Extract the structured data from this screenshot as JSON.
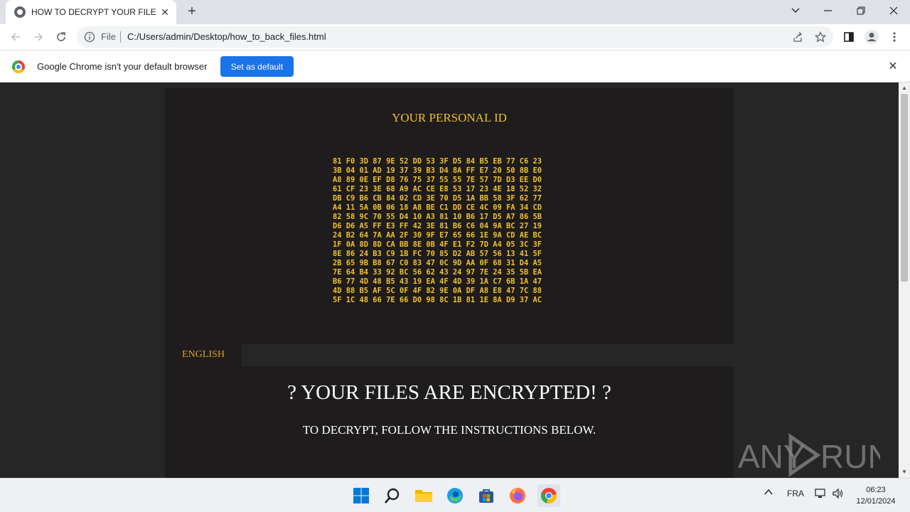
{
  "browser": {
    "tab_title": "HOW TO DECRYPT YOUR FILES",
    "new_tab_label": "+",
    "url_scheme_label": "File",
    "url": "C:/Users/admin/Desktop/how_to_back_files.html"
  },
  "infobar": {
    "message": "Google Chrome isn't your default browser",
    "button_label": "Set as default"
  },
  "page": {
    "id_title": "YOUR PERSONAL ID",
    "hex_lines": [
      "81 F0 3D 87 9E 52 DD 53 3F D5 84 B5 EB 77 C6 23",
      "3B 04 01 AD 19 37 39 B3 D4 8A FF E7 20 50 8B E0",
      "A8 89 0E EF D8 76 75 37 55 55 7E 57 7D D3 EE D0",
      "61 CF 23 3E 68 A9 AC CE E8 53 17 23 4E 18 52 32",
      "DB C9 B6 CB 84 02 CD 3E 70 D5 1A BB 58 3F 62 77",
      "A4 11 5A 0B 06 18 A8 BE C1 DD CE 4C 09 FA 34 CD",
      "82 58 9C 70 55 D4 10 A3 81 10 B6 17 D5 A7 86 5B",
      "D6 D6 A5 FF E3 FF 42 3E 81 B6 C6 04 9A BC 27 19",
      "24 B2 64 7A AA 2F 30 9F E7 65 66 1E 9A CD AE BC",
      "1F 0A 8D 8D CA BB 8E 0B 4F E1 F2 7D A4 05 3C 3F",
      "8E 86 24 B3 C9 1B FC 70 85 D2 AB 57 56 13 41 5F",
      "2B 65 9B B8 67 C0 83 47 0C 9D AA 0F 68 31 D4 A5",
      "7E 64 B4 33 92 BC 56 62 43 24 97 7E 24 35 5B EA",
      "B6 77 4D 48 B5 43 19 EA 4F 4D 39 1A C7 6B 1A 47",
      "4D 88 B5 AF 5C 0F 4F 82 9E 0A DF A8 E8 47 7C 88",
      "5F 1C 48 66 7E 66 D0 98 8C 1B 81 1E 8A D9 37 AC"
    ],
    "language_tab": "ENGLISH",
    "headline": "? YOUR FILES ARE ENCRYPTED! ?",
    "subline": "TO DECRYPT, FOLLOW THE INSTRUCTIONS BELOW."
  },
  "watermark": {
    "text": "ANY RUN"
  },
  "taskbar": {
    "language": "FRA",
    "time": "06:23",
    "date": "12/01/2024"
  },
  "colors": {
    "page_bg": "#262626",
    "panel_bg": "#1e1c1c",
    "accent_yellow": "#f0c030",
    "chrome_blue": "#1a73e8"
  },
  "icons": [
    "globe-icon",
    "close-icon",
    "back-icon",
    "forward-icon",
    "reload-icon",
    "info-icon",
    "share-icon",
    "star-icon",
    "sidepanel-icon",
    "profile-icon",
    "menu-icon",
    "chrome-logo",
    "windows-start-icon",
    "search-icon",
    "file-explorer-icon",
    "edge-icon",
    "store-icon",
    "firefox-icon",
    "chrome-icon"
  ]
}
